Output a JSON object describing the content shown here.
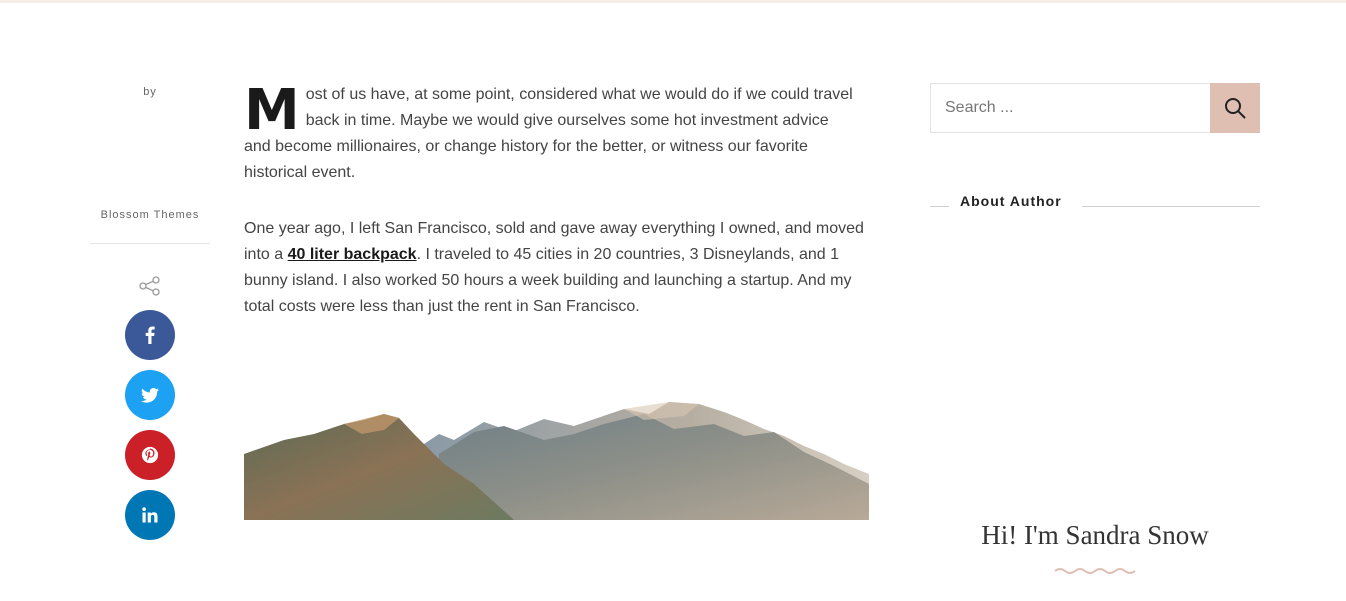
{
  "meta": {
    "by_label": "by",
    "author_name": "Blossom Themes"
  },
  "share": {
    "icon": "share-icon",
    "buttons": [
      {
        "network": "facebook",
        "icon": "facebook-icon",
        "color": "#3b5998"
      },
      {
        "network": "twitter",
        "icon": "twitter-icon",
        "color": "#1da1f2"
      },
      {
        "network": "pinterest",
        "icon": "pinterest-icon",
        "color": "#cb2027"
      },
      {
        "network": "linkedin",
        "icon": "linkedin-icon",
        "color": "#0077b5"
      }
    ]
  },
  "article": {
    "dropcap": "M",
    "paragraph1_rest": "ost of us have, at some point, considered what we would do if we could travel back in time. Maybe we would give ourselves some hot investment advice and become millionaires, or change history for the better, or witness our favorite historical event.",
    "paragraph2_before": "One year ago, I left San Francisco, sold and gave away everything I owned, and moved into a ",
    "paragraph2_link": "40 liter backpack",
    "paragraph2_after": ". I traveled to 45 cities in 20 countries, 3 Disneylands, and 1 bunny island. I also worked 50 hours a week building and launching a startup. And my total costs were less than just the rent in San Francisco."
  },
  "sidebar": {
    "search": {
      "placeholder": "Search ...",
      "value": "",
      "button_icon": "search-icon"
    },
    "about_title": "About Author",
    "author_greeting": "Hi! I'm Sandra Snow"
  },
  "colors": {
    "accent": "#e0bfb3",
    "text": "#444444",
    "heading": "#222222"
  }
}
